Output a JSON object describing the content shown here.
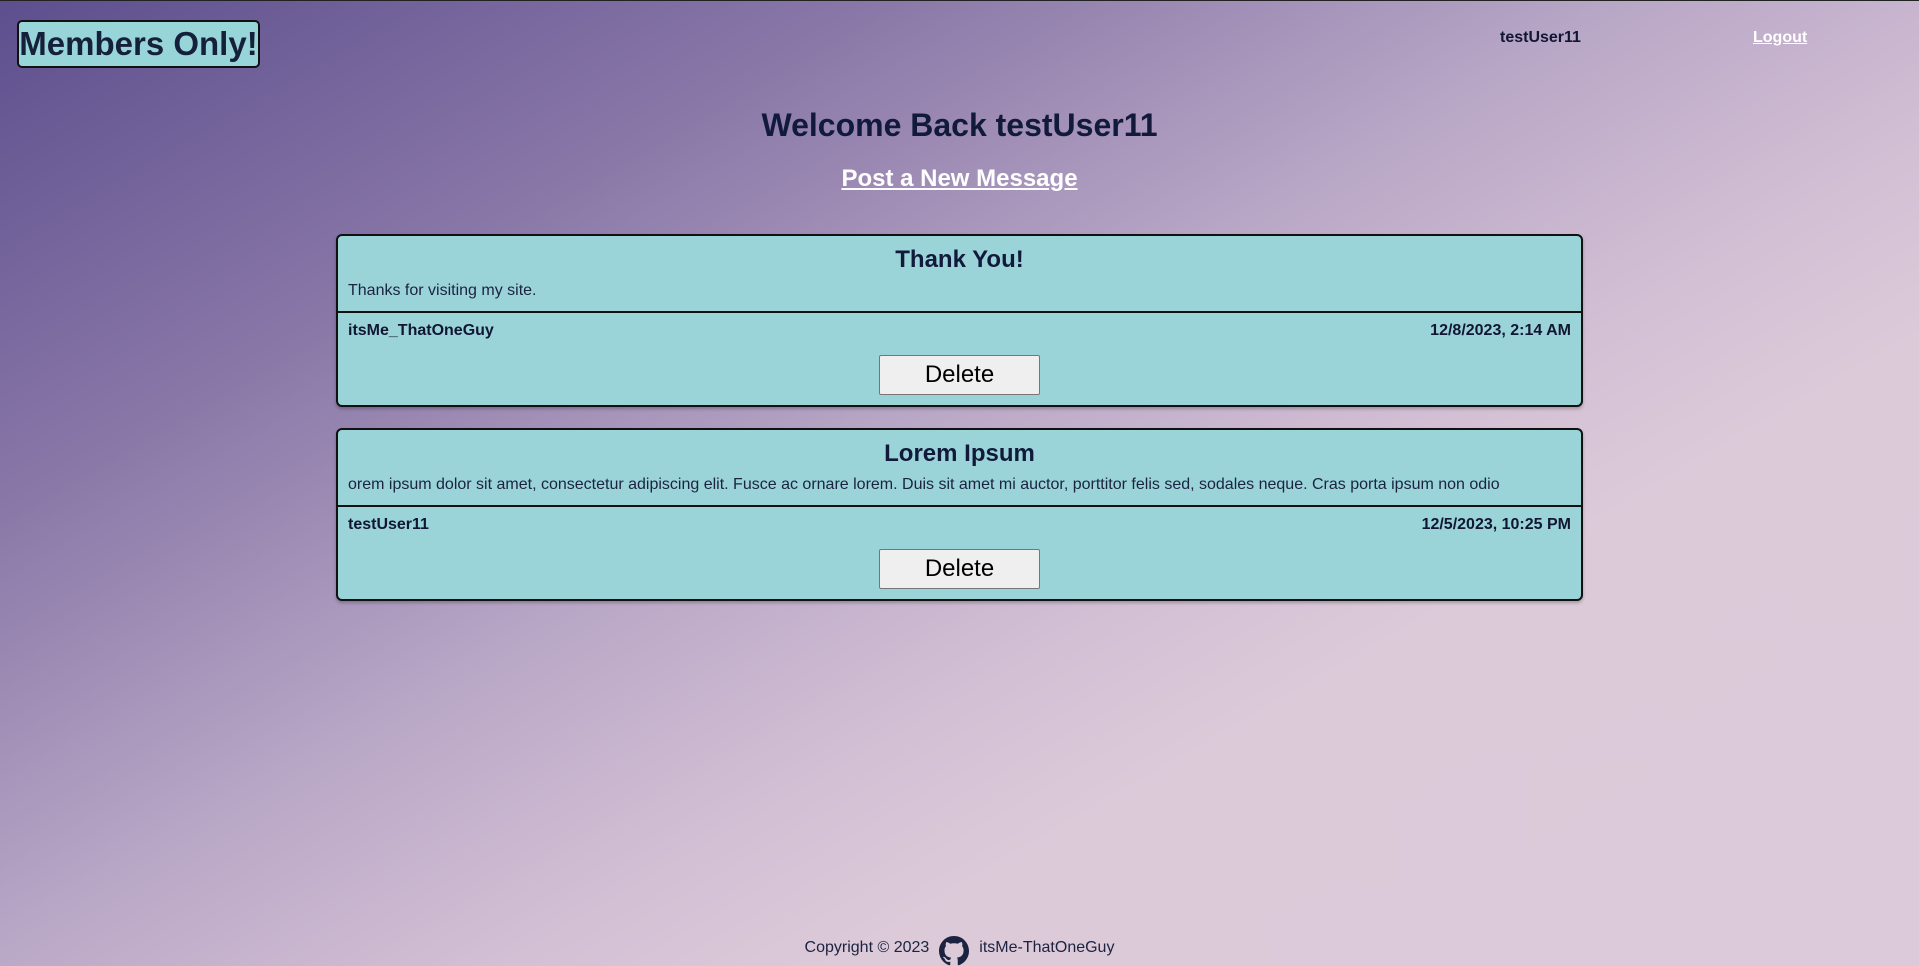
{
  "header": {
    "logo_text": "Members Only!",
    "username": "testUser11",
    "logout_label": "Logout"
  },
  "main": {
    "welcome": "Welcome Back testUser11",
    "new_message_label": "Post a New Message"
  },
  "messages": [
    {
      "title": "Thank You!",
      "body": "Thanks for visiting my site.",
      "author": "itsMe_ThatOneGuy",
      "timestamp": "12/8/2023, 2:14 AM",
      "delete_label": "Delete"
    },
    {
      "title": "Lorem Ipsum",
      "body": "orem ipsum dolor sit amet, consectetur adipiscing elit. Fusce ac ornare lorem. Duis sit amet mi auctor, porttitor felis sed, sodales neque. Cras porta ipsum non odio",
      "author": "testUser11",
      "timestamp": "12/5/2023, 10:25 PM",
      "delete_label": "Delete"
    }
  ],
  "footer": {
    "copyright": "Copyright © 2023",
    "github_icon": "github-icon",
    "github_user": "itsMe-ThatOneGuy"
  },
  "colors": {
    "card_bg": "#9ad4d8",
    "logo_bg": "#98d5d8",
    "text_dark": "#111a3a",
    "link": "#ffffff"
  }
}
